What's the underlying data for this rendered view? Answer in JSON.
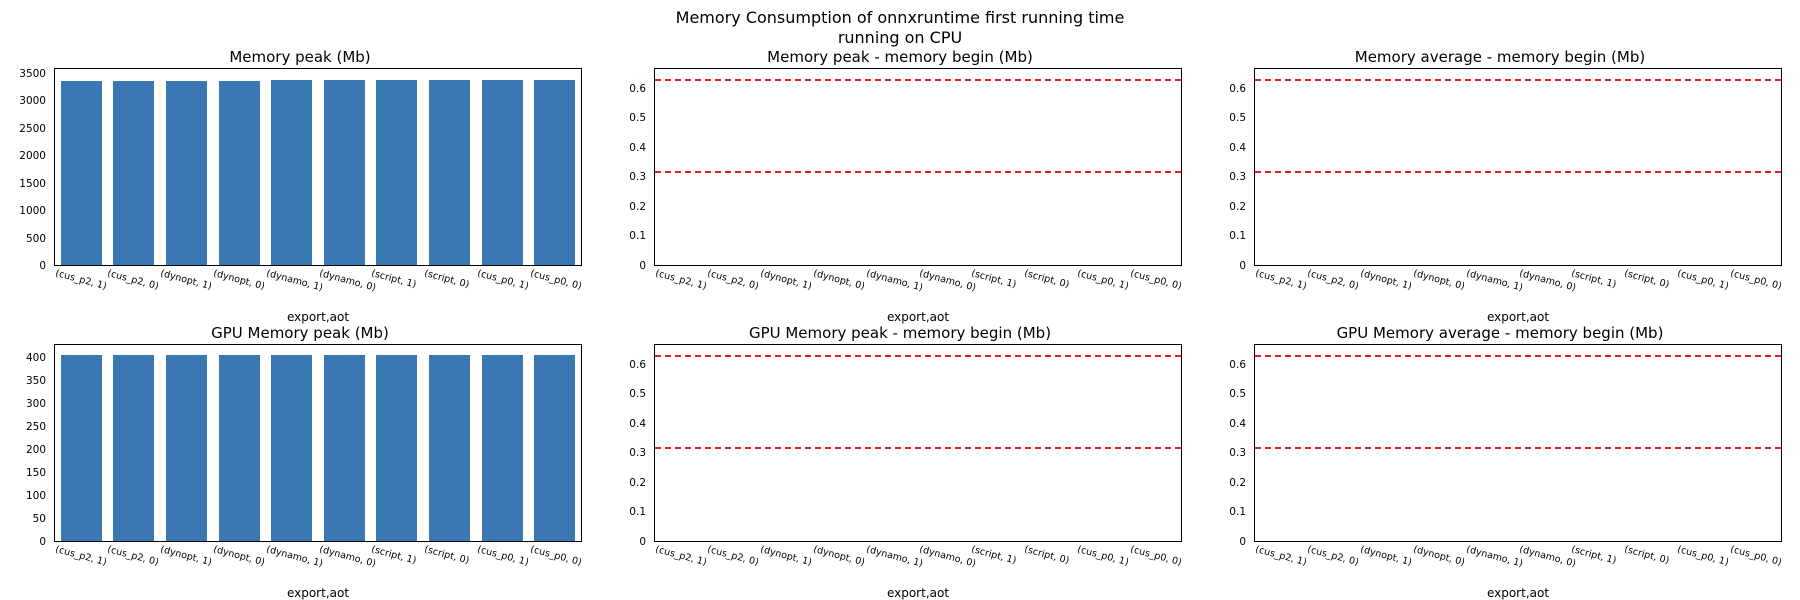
{
  "suptitle": "Memory Consumption of onnxruntime first running time\nrunning on CPU",
  "xlabel": "export,aot",
  "categories": [
    "(cus_p2, 1)",
    "(cus_p2, 0)",
    "(dynopt, 1)",
    "(dynopt, 0)",
    "(dynamo, 1)",
    "(dynamo, 0)",
    "(script, 1)",
    "(script, 0)",
    "(cus_p0, 1)",
    "(cus_p0, 0)"
  ],
  "chart_data": [
    {
      "title": "Memory peak (Mb)",
      "type": "bar",
      "ylim": [
        0,
        3600
      ],
      "yticks": [
        0,
        500,
        1000,
        1500,
        2000,
        2500,
        3000,
        3500
      ],
      "values": [
        3380,
        3380,
        3380,
        3385,
        3390,
        3395,
        3395,
        3400,
        3400,
        3400
      ]
    },
    {
      "title": "Memory peak - memory begin (Mb)",
      "type": "hlines",
      "ylim": [
        0.0,
        0.67
      ],
      "yticks": [
        0.0,
        0.1,
        0.2,
        0.3,
        0.4,
        0.5,
        0.6
      ],
      "hlines": [
        0.315,
        0.63
      ]
    },
    {
      "title": "Memory average - memory begin (Mb)",
      "type": "hlines",
      "ylim": [
        0.0,
        0.67
      ],
      "yticks": [
        0.0,
        0.1,
        0.2,
        0.3,
        0.4,
        0.5,
        0.6
      ],
      "hlines": [
        0.315,
        0.63
      ]
    },
    {
      "title": "GPU Memory peak (Mb)",
      "type": "bar",
      "ylim": [
        0,
        430
      ],
      "yticks": [
        0,
        50,
        100,
        150,
        200,
        250,
        300,
        350,
        400
      ],
      "values": [
        408,
        408,
        408,
        408,
        408,
        408,
        408,
        408,
        408,
        408
      ]
    },
    {
      "title": "GPU Memory peak - memory begin (Mb)",
      "type": "hlines",
      "ylim": [
        0.0,
        0.67
      ],
      "yticks": [
        0.0,
        0.1,
        0.2,
        0.3,
        0.4,
        0.5,
        0.6
      ],
      "hlines": [
        0.315,
        0.63
      ]
    },
    {
      "title": "GPU Memory average - memory begin (Mb)",
      "type": "hlines",
      "ylim": [
        0.0,
        0.67
      ],
      "yticks": [
        0.0,
        0.1,
        0.2,
        0.3,
        0.4,
        0.5,
        0.6
      ],
      "hlines": [
        0.315,
        0.63
      ]
    }
  ]
}
